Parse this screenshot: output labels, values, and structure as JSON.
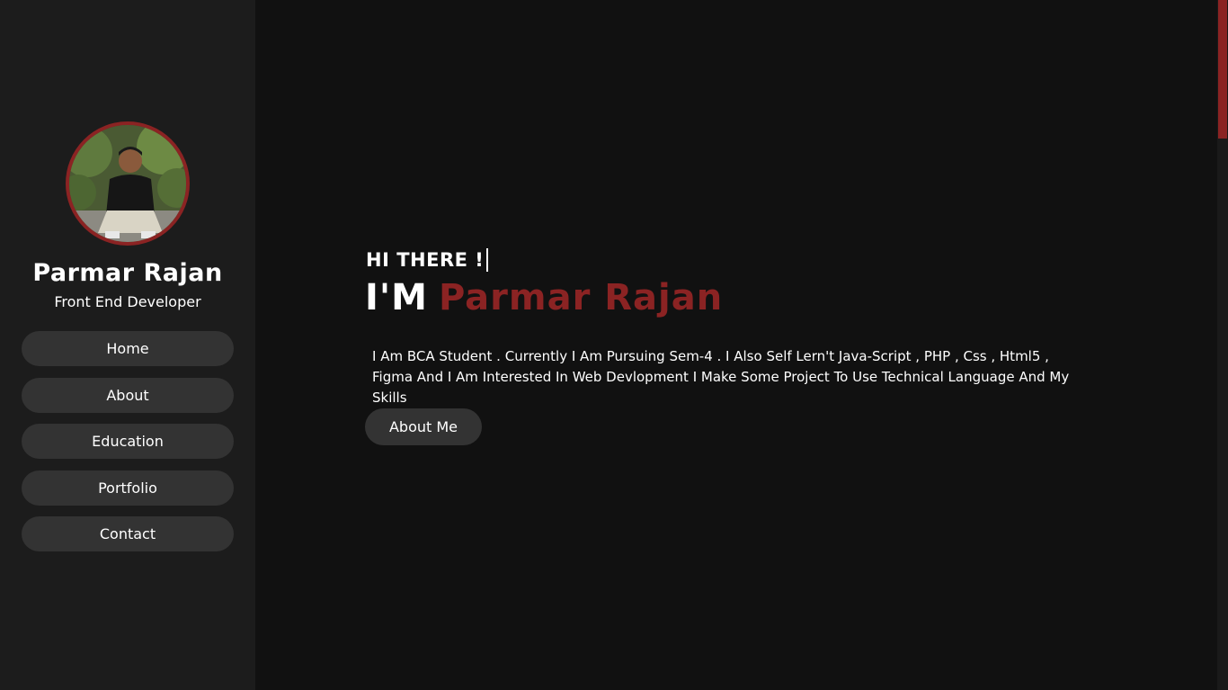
{
  "sidebar": {
    "profile": {
      "name": "Parmar Rajan",
      "role": "Front End Developer"
    },
    "nav": [
      {
        "label": "Home"
      },
      {
        "label": "About"
      },
      {
        "label": "Education"
      },
      {
        "label": "Portfolio"
      },
      {
        "label": "Contact"
      }
    ]
  },
  "hero": {
    "greeting": "HI THERE !",
    "prefix": "I'M",
    "name": "Parmar Rajan",
    "intro": "I Am BCA Student . Currently I Am Pursuing Sem-4 . I Also Self Lern't Java-Script , PHP , Css , Html5 , Figma And I Am Interested In Web Devlopment I Make Some Project To Use Technical Language And My Skills",
    "cta_label": "About Me"
  },
  "colors": {
    "accent": "#8b2323",
    "sidebar_bg": "#1c1c1c",
    "main_bg": "#111111",
    "button_bg": "#333333",
    "text": "#ffffff"
  }
}
